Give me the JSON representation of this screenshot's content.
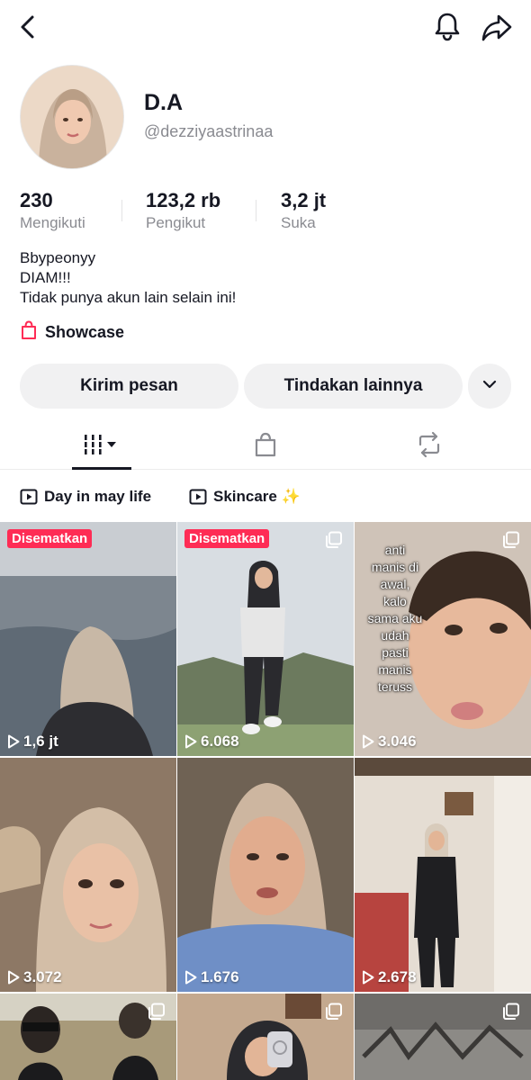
{
  "profile": {
    "display_name": "D.A",
    "username": "@dezziyaastrinaa",
    "bio": [
      "Bbypeonyy",
      "DIAM!!!",
      "Tidak punya akun lain selain ini!"
    ]
  },
  "stats": [
    {
      "value": "230",
      "label": "Mengikuti"
    },
    {
      "value": "123,2 rb",
      "label": "Pengikut"
    },
    {
      "value": "3,2 jt",
      "label": "Suka"
    }
  ],
  "showcase_label": "Showcase",
  "actions": {
    "message": "Kirim pesan",
    "more_actions": "Tindakan lainnya"
  },
  "tabs": [
    "videos-grid-icon",
    "shop-bag-icon",
    "repost-icon"
  ],
  "playlists": [
    "Day in may life",
    "Skincare ✨"
  ],
  "videos": [
    {
      "views": "1,6 jt",
      "pinned": "Disematkan"
    },
    {
      "views": "6.068",
      "pinned": "Disematkan"
    },
    {
      "views": "3.046",
      "overlay_text": "anti manis di awal, kalo sama aku udah pasti manis teruss"
    },
    {
      "views": "3.072"
    },
    {
      "views": "1.676"
    },
    {
      "views": "2.678"
    }
  ],
  "colors": {
    "accent": "#fe2c55",
    "muted": "#8a8b91",
    "button_bg": "#f1f1f2"
  }
}
